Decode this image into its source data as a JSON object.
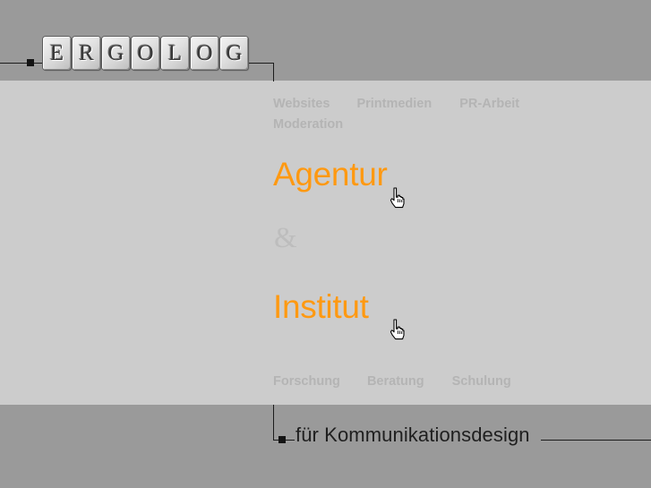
{
  "page": {
    "background_color": "#9a9a9a",
    "panel_color": "#cccccc",
    "accent_color": "#ff9911",
    "muted_color": "#b4b4b4",
    "line_color": "#1c1c1c"
  },
  "logo": {
    "name": "ERGOLOG",
    "tiles": [
      "E",
      "R",
      "G",
      "O",
      "L",
      "O",
      "G"
    ]
  },
  "nav_top": {
    "items": [
      {
        "label": "Websites"
      },
      {
        "label": "Printmedien"
      },
      {
        "label": "PR-Arbeit"
      }
    ],
    "second_row": [
      {
        "label": "Moderation"
      }
    ]
  },
  "main": {
    "agentur": "Agentur",
    "ampersand": "&",
    "institut": "Institut"
  },
  "nav_bottom": {
    "items": [
      {
        "label": "Forschung"
      },
      {
        "label": "Beratung"
      },
      {
        "label": "Schulung"
      }
    ]
  },
  "footer": {
    "tagline": "für Kommunikationsdesign"
  },
  "cursors": [
    {
      "name": "pointing-hand-cursor-agentur"
    },
    {
      "name": "pointing-hand-cursor-institut"
    }
  ]
}
